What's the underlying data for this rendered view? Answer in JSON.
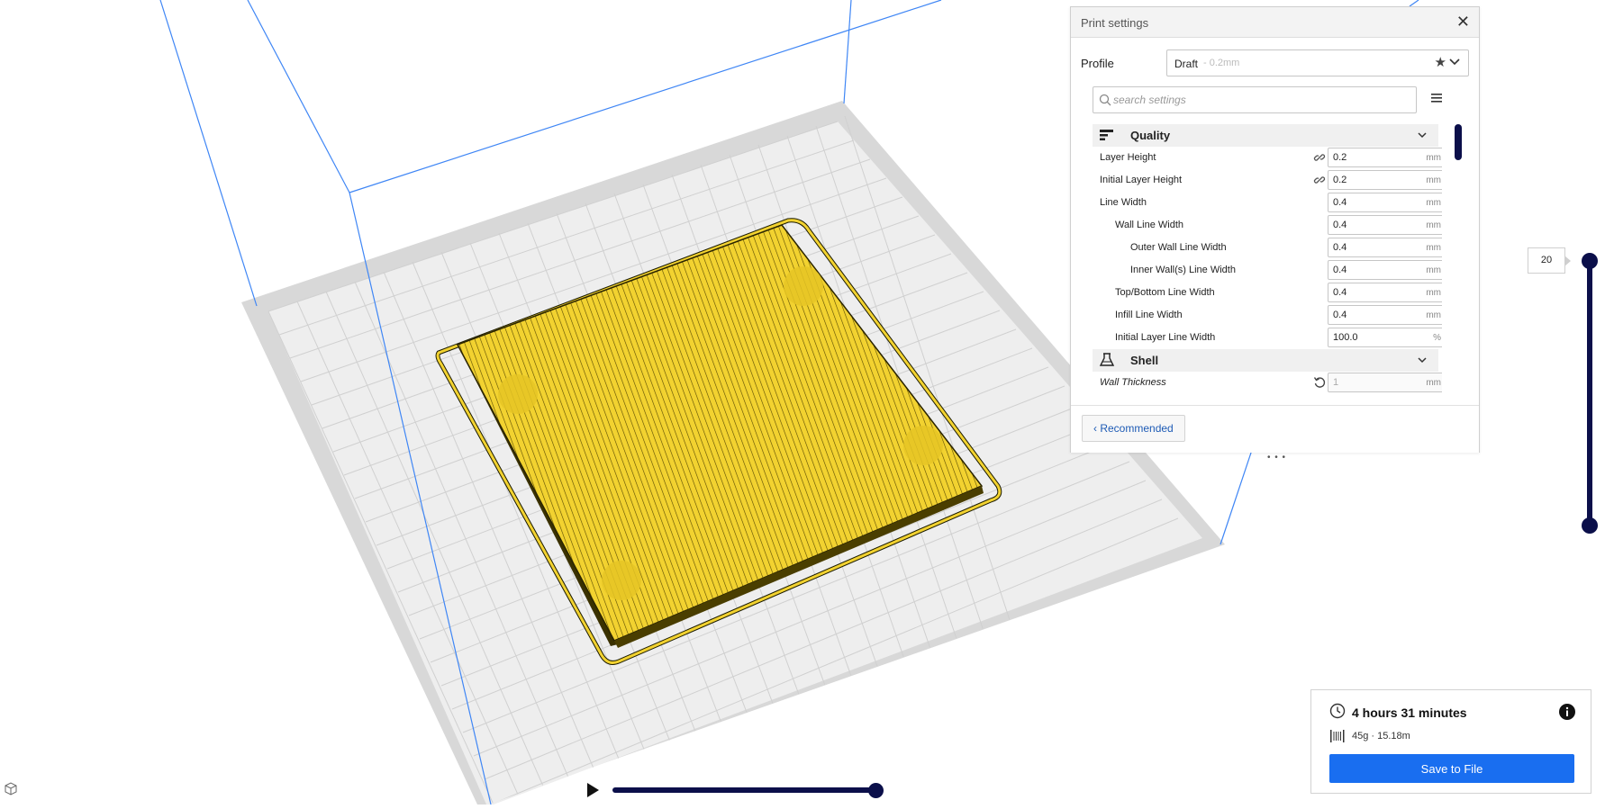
{
  "viewport": {
    "model_color": "#f2d230",
    "build_volume_line_color": "#3f86f5"
  },
  "print_settings": {
    "title": "Print settings",
    "close_icon": "close-icon",
    "profile_label": "Profile",
    "profile_name": "Draft",
    "profile_layer": "- 0.2mm",
    "search_placeholder": "search settings",
    "categories": [
      {
        "name": "Quality",
        "icon": "quality-icon",
        "settings": [
          {
            "label": "Layer Height",
            "value": "0.2",
            "unit": "mm",
            "indent": 0,
            "linked": true
          },
          {
            "label": "Initial Layer Height",
            "value": "0.2",
            "unit": "mm",
            "indent": 0,
            "linked": true
          },
          {
            "label": "Line Width",
            "value": "0.4",
            "unit": "mm",
            "indent": 0
          },
          {
            "label": "Wall Line Width",
            "value": "0.4",
            "unit": "mm",
            "indent": 1
          },
          {
            "label": "Outer Wall Line Width",
            "value": "0.4",
            "unit": "mm",
            "indent": 2
          },
          {
            "label": "Inner Wall(s) Line Width",
            "value": "0.4",
            "unit": "mm",
            "indent": 2
          },
          {
            "label": "Top/Bottom Line Width",
            "value": "0.4",
            "unit": "mm",
            "indent": 1
          },
          {
            "label": "Infill Line Width",
            "value": "0.4",
            "unit": "mm",
            "indent": 1
          },
          {
            "label": "Initial Layer Line Width",
            "value": "100.0",
            "unit": "%",
            "indent": 1
          }
        ]
      },
      {
        "name": "Shell",
        "icon": "shell-icon",
        "settings": [
          {
            "label": "Wall Thickness",
            "value": "1",
            "unit": "mm",
            "indent": 0,
            "reset": true
          }
        ]
      }
    ],
    "recommended_label": "Recommended",
    "grip_text": "• • •"
  },
  "layer_slider": {
    "value": "20"
  },
  "print_info": {
    "time": "4 hours 31 minutes",
    "material": "45g · 15.18m",
    "save_label": "Save to File",
    "accent_color": "#196ef0"
  }
}
